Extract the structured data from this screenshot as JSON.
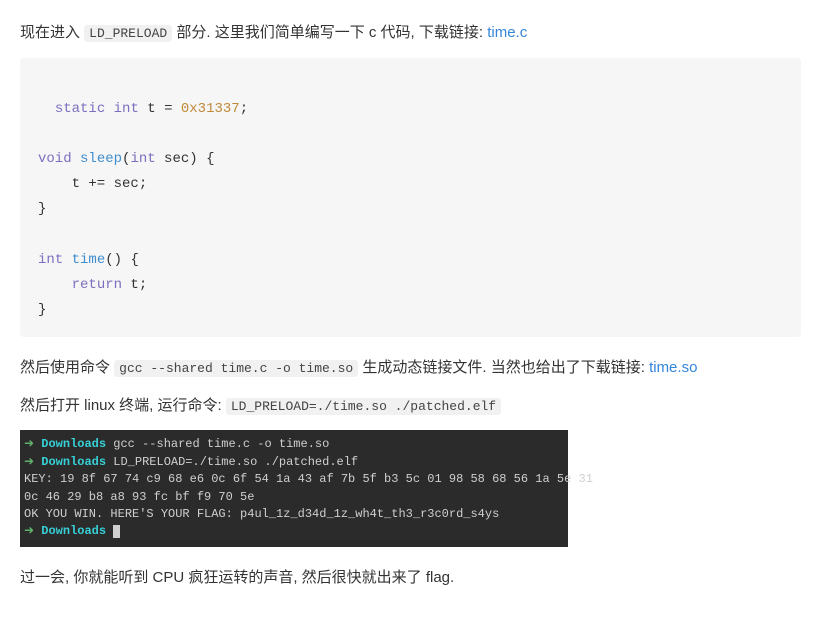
{
  "para1": {
    "pre": "现在进入 ",
    "code": "LD_PRELOAD",
    "mid": " 部分. 这里我们简单编写一下 c 代码, 下载链接: ",
    "link": "time.c"
  },
  "codeblock": {
    "l1_kw1": "static",
    "l1_kw2": "int",
    "l1_var": " t = ",
    "l1_num": "0x31337",
    "l1_end": ";",
    "l3_kw": "void",
    "l3_fn": "sleep",
    "l3_paren_open": "(",
    "l3_argtype": "int",
    "l3_rest": " sec) {",
    "l4": "    t += sec;",
    "l5": "}",
    "l7_kw": "int",
    "l7_fn": "time",
    "l7_rest": "() {",
    "l8_kw": "return",
    "l8_rest": " t;",
    "l9": "}"
  },
  "para2": {
    "pre": "然后使用命令 ",
    "code": "gcc --shared time.c -o time.so",
    "post": " 生成动态链接文件. 当然也给出了下载链接: ",
    "link": "time.so"
  },
  "para3": {
    "pre": "然后打开 linux 终端, 运行命令: ",
    "code": "LD_PRELOAD=./time.so ./patched.elf"
  },
  "terminal": {
    "arrow": "➜ ",
    "cwd": "Downloads",
    "cmd1": " gcc --shared time.c -o time.so",
    "cmd2": " LD_PRELOAD=./time.so ./patched.elf",
    "out1": "KEY: 19 8f 67 74 c9 68 e6 0c 6f 54 1a 43 af 7b 5f b3 5c 01 98 58 68 56 1a 5e 31",
    "out2": "0c 46 29 b8 a8 93 fc bf f9 70 5e",
    "out3": "OK YOU WIN. HERE'S YOUR FLAG: p4ul_1z_d34d_1z_wh4t_th3_r3c0rd_s4ys"
  },
  "para4": "过一会, 你就能听到 CPU 疯狂运转的声音, 然后很快就出来了 flag."
}
